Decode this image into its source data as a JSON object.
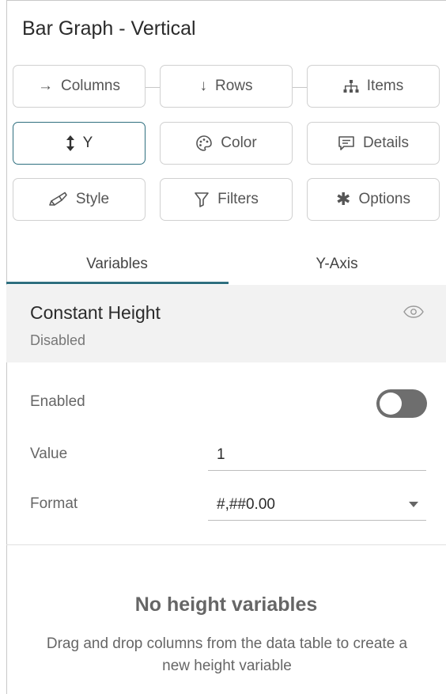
{
  "panel": {
    "title": "Bar Graph - Vertical"
  },
  "buttons": {
    "columns": {
      "label": "Columns",
      "icon": "arrow-right-icon"
    },
    "rows": {
      "label": "Rows",
      "icon": "arrow-down-icon"
    },
    "items": {
      "label": "Items",
      "icon": "hierarchy-icon"
    },
    "y": {
      "label": "Y",
      "icon": "vertical-arrows-icon"
    },
    "color": {
      "label": "Color",
      "icon": "palette-icon"
    },
    "details": {
      "label": "Details",
      "icon": "comment-icon"
    },
    "style": {
      "label": "Style",
      "icon": "brush-icon"
    },
    "filters": {
      "label": "Filters",
      "icon": "funnel-icon"
    },
    "options": {
      "label": "Options",
      "icon": "gear-icon"
    }
  },
  "tabs": [
    {
      "label": "Variables",
      "active": true
    },
    {
      "label": "Y-Axis",
      "active": false
    }
  ],
  "section": {
    "title": "Constant Height",
    "subtitle": "Disabled"
  },
  "form": {
    "enabled_label": "Enabled",
    "enabled": false,
    "value_label": "Value",
    "value": "1",
    "format_label": "Format",
    "format": "#,##0.00"
  },
  "empty_state": {
    "title": "No height variables",
    "description": "Drag and drop columns from the data table to create a new height variable"
  },
  "colors": {
    "accent": "#2f6f7f",
    "toggle_off": "#6e6e6e",
    "section_bg": "#f2f2f2"
  }
}
